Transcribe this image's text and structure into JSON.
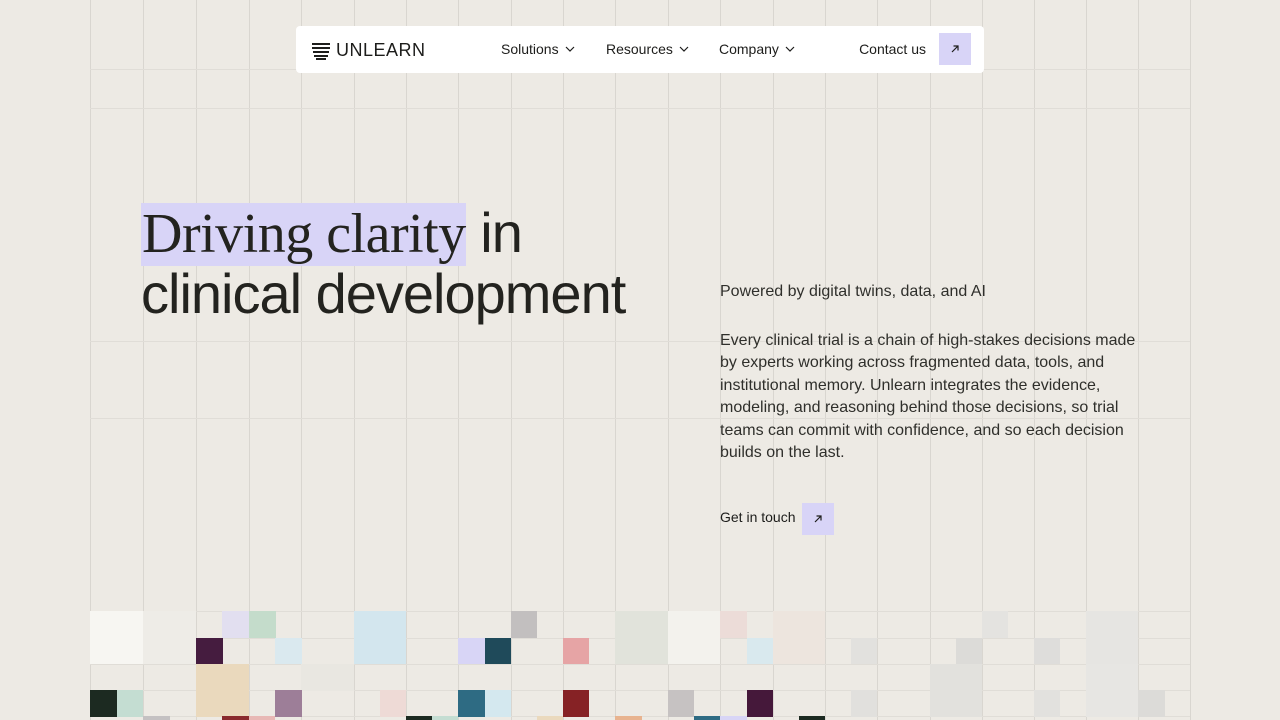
{
  "nav": {
    "logo_text": "UNLEARN",
    "items": [
      {
        "label": "Solutions"
      },
      {
        "label": "Resources"
      },
      {
        "label": "Company"
      }
    ],
    "contact_label": "Contact us"
  },
  "hero": {
    "title_highlight": "Driving clarity",
    "title_line1_rest": " in",
    "title_line2": "clinical development",
    "subtitle": "Powered by digital twins, data, and AI",
    "body": "Every clinical trial is a chain of high-stakes decisions made by experts working across fragmented data, tools, and institutional memory. Unlearn integrates the evidence, modeling, and reasoning behind those decisions, so trial teams can commit with confidence, and so each decision builds on the last.",
    "cta_label": "Get in touch"
  },
  "colors": {
    "background": "#edeae4",
    "accent": "#d8d4f7",
    "text": "#23231f"
  },
  "icons": {
    "nav_dropdown": "chevron-down-icon",
    "contact_arrow": "arrow-up-right-icon",
    "cta_arrow": "arrow-up-right-icon",
    "logo": "striped-logo-mark"
  }
}
